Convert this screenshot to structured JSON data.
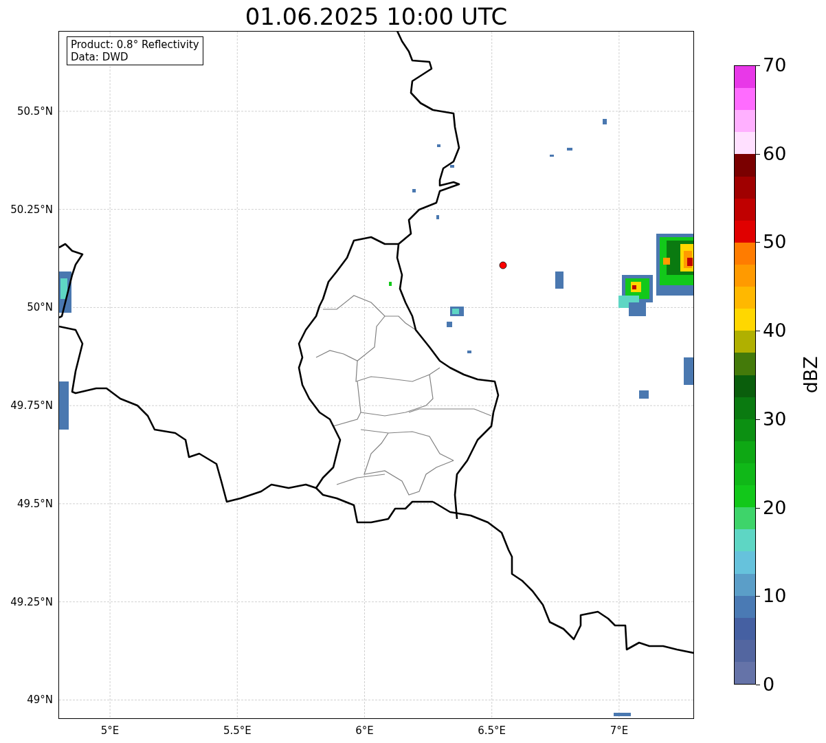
{
  "title": "01.06.2025 10:00 UTC",
  "info_box": [
    "Product: 0.8° Reflectivity",
    "Data: DWD"
  ],
  "map": {
    "xticks": [
      "5°E",
      "5.5°E",
      "6°E",
      "6.5°E",
      "7°E"
    ],
    "yticks": [
      "50.5°N",
      "50.25°N",
      "50°N",
      "49.75°N",
      "49.5°N",
      "49.25°N",
      "49°N"
    ]
  },
  "colorbar": {
    "label": "dBZ",
    "ticks": [
      "70",
      "60",
      "50",
      "40",
      "30",
      "20",
      "10",
      "0"
    ],
    "segments": [
      {
        "color": "#e838e8"
      },
      {
        "color": "#ff6cff"
      },
      {
        "color": "#ffb0ff"
      },
      {
        "color": "#ffe0ff"
      },
      {
        "color": "#7a0000"
      },
      {
        "color": "#a00000"
      },
      {
        "color": "#c00000"
      },
      {
        "color": "#e00000"
      },
      {
        "color": "#ff7c00"
      },
      {
        "color": "#ff9a00"
      },
      {
        "color": "#ffb800"
      },
      {
        "color": "#ffd700"
      },
      {
        "color": "#b0b000"
      },
      {
        "color": "#447a0a"
      },
      {
        "color": "#0a5e0c"
      },
      {
        "color": "#0a7a10"
      },
      {
        "color": "#0c9012"
      },
      {
        "color": "#0ea814"
      },
      {
        "color": "#10b818"
      },
      {
        "color": "#12c81a"
      },
      {
        "color": "#3ed46a"
      },
      {
        "color": "#5ed6c4"
      },
      {
        "color": "#66c2dc"
      },
      {
        "color": "#5b9ec8"
      },
      {
        "color": "#4a7ab4"
      },
      {
        "color": "#4560a2"
      },
      {
        "color": "#5366a0"
      },
      {
        "color": "#6573a8"
      }
    ]
  }
}
